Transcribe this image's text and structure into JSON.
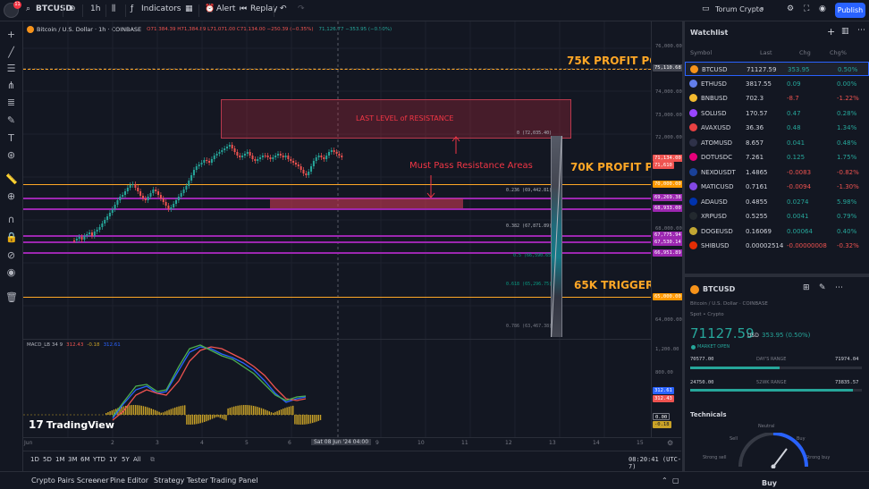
{
  "topbar": {
    "symbol": "BTCUSD",
    "interval": "1h",
    "indicators": "Indicators",
    "alert": "Alert",
    "replay": "Replay",
    "profile": "Torum Crypto",
    "publish": "Publish",
    "notif_count": "11"
  },
  "legend": {
    "title": "Bitcoin / U.S. Dollar · 1h · COINBASE",
    "ohlc": "O71,384.39 H71,384.89 L71,071.00 C71,134.00 −250.39 (−0.35%)",
    "extra": "71,126.77  −353.95 (−0.50%)",
    "macd_label": "MACD_LB 34 9",
    "macd_v1": "312.43",
    "macd_v2": "-0.18",
    "macd_v3": "312.61"
  },
  "annotations": {
    "profit75": "75K PROFIT POINT",
    "profit70": "70K PROFIT POINT",
    "trigger65": "65K TRIGGER POINT",
    "last_resistance": "LAST LEVEL of RESISTANCE",
    "must_pass": "Must Pass Resistance Areas"
  },
  "fib": {
    "f0": "0 (72,035.40)",
    "f236": "0.236 (69,442.81)",
    "f382": "0.382 (67,871.89)",
    "f5": "0.5 (66,590.65)",
    "f618": "0.618 (65,296.75)",
    "f786": "0.786 (63,467.38)"
  },
  "price_axis": {
    "ticks": [
      "76,000.00",
      "75,000.00",
      "74,000.00",
      "73,000.00",
      "72,000.00",
      "71,000.00",
      "70,000.00",
      "69,000.00",
      "68,000.00",
      "67,000.00",
      "66,000.00",
      "65,000.00",
      "64,000.00"
    ],
    "macd_ticks": [
      "1,200.00",
      "800.00",
      "400.00",
      "0.00",
      "-400.00"
    ],
    "tag_75": "75,110.68",
    "tag_last": "71,134.00",
    "tag_last2": "71,610",
    "tag_70": "70,000.00",
    "tag_69a": "69,269.38",
    "tag_69b": "68,933.00",
    "tag_67a": "67,775.94",
    "tag_67b": "67,530.14",
    "tag_66": "66,951.89",
    "tag_65": "65,000.00",
    "macd_tag1": "312.61",
    "macd_tag2": "312.43",
    "macd_tag3": "0.00",
    "macd_tag4": "-0.18"
  },
  "time_axis": {
    "labels": [
      "Jun",
      "2",
      "3",
      "4",
      "5",
      "6",
      "7",
      "9",
      "10",
      "11",
      "12",
      "13",
      "14",
      "15"
    ],
    "crosshair": "Sat 08 Jun '24   04:00"
  },
  "ranges": [
    "1D",
    "5D",
    "1M",
    "3M",
    "6M",
    "YTD",
    "1Y",
    "5Y",
    "All"
  ],
  "clock": "08:20:41 (UTC-7)",
  "bottom_tabs": [
    "Crypto Pairs Screener",
    "Pine Editor",
    "Strategy Tester",
    "Trading Panel"
  ],
  "watchlist": {
    "title": "Watchlist",
    "headers": [
      "Symbol",
      "Last",
      "Chg",
      "Chg%"
    ],
    "rows": [
      {
        "symbol": "BTCUSD",
        "last": "71127.59",
        "chg": "353.95",
        "pct": "0.50%",
        "color": "#f7931a",
        "dir": "pos"
      },
      {
        "symbol": "ETHUSD",
        "last": "3817.55",
        "chg": "0.09",
        "pct": "0.00%",
        "color": "#627eea",
        "dir": "pos"
      },
      {
        "symbol": "BNBUSD",
        "last": "702.3",
        "chg": "-8.7",
        "pct": "-1.22%",
        "color": "#f3ba2f",
        "dir": "neg"
      },
      {
        "symbol": "SOLUSD",
        "last": "170.57",
        "chg": "0.47",
        "pct": "0.28%",
        "color": "#9945ff",
        "dir": "pos"
      },
      {
        "symbol": "AVAXUSD",
        "last": "36.36",
        "chg": "0.48",
        "pct": "1.34%",
        "color": "#e84142",
        "dir": "pos"
      },
      {
        "symbol": "ATOMUSD",
        "last": "8.657",
        "chg": "0.041",
        "pct": "0.48%",
        "color": "#2e3148",
        "dir": "pos"
      },
      {
        "symbol": "DOTUSDC",
        "last": "7.261",
        "chg": "0.125",
        "pct": "1.75%",
        "color": "#e6007a",
        "dir": "pos"
      },
      {
        "symbol": "NEXOUSDT",
        "last": "1.4865",
        "chg": "-0.0083",
        "pct": "-0.82%",
        "color": "#1a4199",
        "dir": "neg"
      },
      {
        "symbol": "MATICUSD",
        "last": "0.7161",
        "chg": "-0.0094",
        "pct": "-1.30%",
        "color": "#8247e5",
        "dir": "neg"
      },
      {
        "symbol": "ADAUSD",
        "last": "0.4855",
        "chg": "0.0274",
        "pct": "5.98%",
        "color": "#0033ad",
        "dir": "pos"
      },
      {
        "symbol": "XRPUSD",
        "last": "0.5255",
        "chg": "0.0041",
        "pct": "0.79%",
        "color": "#23292f",
        "dir": "pos"
      },
      {
        "symbol": "DOGEUSD",
        "last": "0.16069",
        "chg": "0.00064",
        "pct": "0.40%",
        "color": "#c2a633",
        "dir": "pos"
      },
      {
        "symbol": "SHIBUSD",
        "last": "0.00002514",
        "chg": "-0.00000008",
        "pct": "-0.32%",
        "color": "#e42d04",
        "dir": "neg"
      }
    ]
  },
  "details": {
    "symbol": "BTCUSD",
    "name": "Bitcoin / U.S. Dollar · COINBASE",
    "type": "Spot • Crypto",
    "price": "71127.59",
    "currency": "USD",
    "change": "353.95 (0.50%)",
    "status": "MARKET OPEN",
    "day_low": "70577.00",
    "day_label": "DAY'S RANGE",
    "day_high": "71974.04",
    "year_low": "24750.00",
    "year_label": "52WK RANGE",
    "year_high": "73835.57",
    "technicals": "Technicals",
    "neutral": "Neutral",
    "sell": "Sell",
    "buy": "Buy",
    "strong_sell": "Strong sell",
    "strong_buy": "Strong buy",
    "rating": "Buy"
  },
  "brand": "TradingView",
  "colors": {
    "accent": "#2962ff",
    "orange": "#ffa726",
    "green": "#26a69a",
    "red": "#ef5350",
    "purple": "#9c27b0"
  }
}
